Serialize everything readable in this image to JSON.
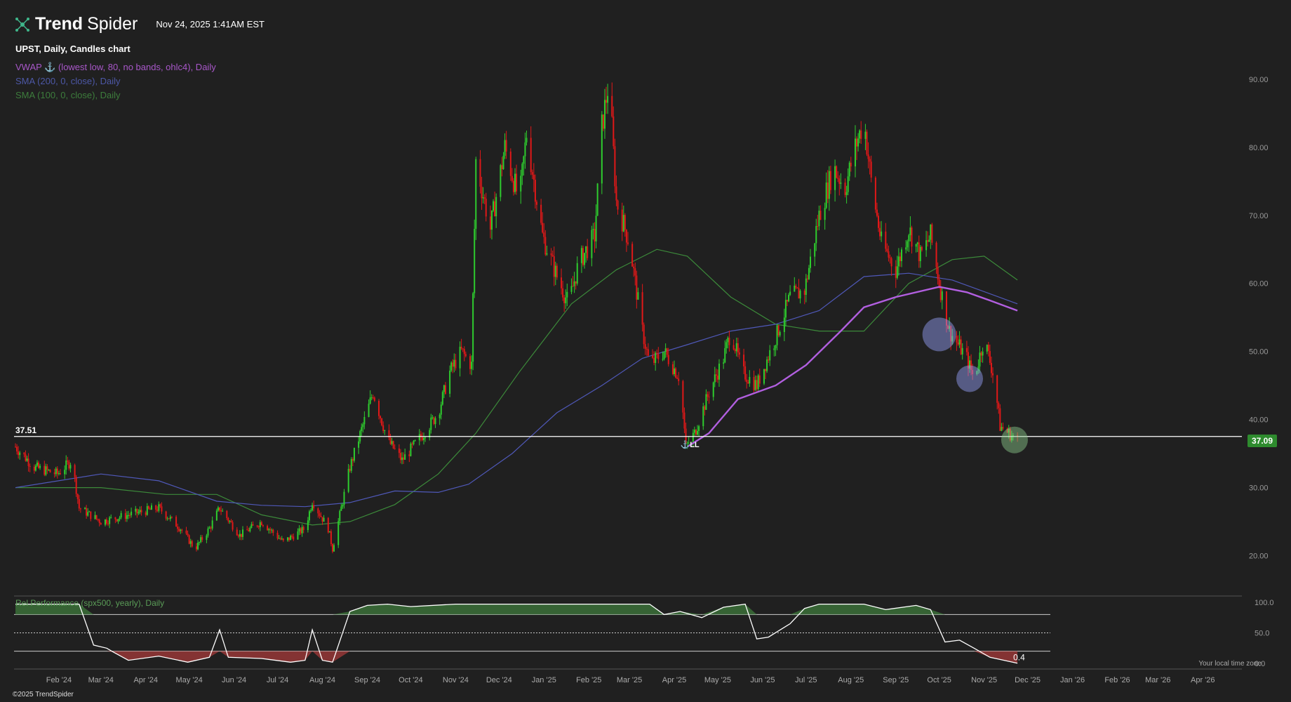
{
  "app": {
    "logo_trend": "Trend",
    "logo_spider": "Spider",
    "timestamp": "Nov 24, 2025 1:41AM EST",
    "copyright": "©2025 TrendSpider",
    "local_time_note": "Your local time zone"
  },
  "legend": {
    "title": "UPST, Daily, Candles chart",
    "vwap": "VWAP ⚓ (lowest low, 80, no bands, ohlc4), Daily",
    "sma200": "SMA (200, 0, close), Daily",
    "sma100": "SMA (100, 0, close), Daily"
  },
  "lower_pane": {
    "label": "Rel Performance (spx500, yearly), Daily",
    "last_value": "0.4",
    "y_ticks": [
      "100.0",
      "50.0",
      "0.0"
    ]
  },
  "colors": {
    "background": "#202020",
    "up": "#2ecc2e",
    "down": "#e01818",
    "vwap": "#b25fe0",
    "sma200": "#4f58b8",
    "sma100": "#3c8a3a",
    "price_tag": "#2e8b2e"
  },
  "annotations": {
    "level_label": "37.51",
    "anchor_label": "⚓LL",
    "price_tag": "37.09"
  },
  "chart_data": {
    "type": "candlestick",
    "symbol": "UPST",
    "interval": "Daily",
    "ylim": [
      15,
      97
    ],
    "y_ticks": [
      20,
      30,
      40,
      50,
      60,
      70,
      80,
      90
    ],
    "horizontal_level": 37.51,
    "last_price": 37.09,
    "x_ticks": [
      "Feb '24",
      "Mar '24",
      "Apr '24",
      "May '24",
      "Jun '24",
      "Jul '24",
      "Aug '24",
      "Sep '24",
      "Oct '24",
      "Nov '24",
      "Dec '24",
      "Jan '25",
      "Feb '25",
      "Mar '25",
      "Apr '25",
      "May '25",
      "Jun '25",
      "Jul '25",
      "Aug '25",
      "Sep '25",
      "Oct '25",
      "Nov '25",
      "Dec '25",
      "Jan '26",
      "Feb '26",
      "Mar '26",
      "Apr '26"
    ],
    "x_tick_dates": [
      "2024-02-01",
      "2024-03-01",
      "2024-04-01",
      "2024-05-01",
      "2024-06-01",
      "2024-07-01",
      "2024-08-01",
      "2024-09-01",
      "2024-10-01",
      "2024-11-01",
      "2024-12-01",
      "2025-01-01",
      "2025-02-01",
      "2025-03-01",
      "2025-04-01",
      "2025-05-01",
      "2025-06-01",
      "2025-07-01",
      "2025-08-01",
      "2025-09-01",
      "2025-10-01",
      "2025-11-01",
      "2025-12-01",
      "2026-01-01",
      "2026-02-01",
      "2026-03-01",
      "2026-04-01"
    ],
    "date_range": [
      "2024-01-02",
      "2026-04-28"
    ],
    "close_path": [
      [
        "2024-01-02",
        36
      ],
      [
        "2024-01-15",
        33
      ],
      [
        "2024-01-31",
        32
      ],
      [
        "2024-02-10",
        34
      ],
      [
        "2024-02-15",
        27
      ],
      [
        "2024-03-01",
        25
      ],
      [
        "2024-03-20",
        26
      ],
      [
        "2024-04-10",
        27
      ],
      [
        "2024-04-25",
        24
      ],
      [
        "2024-05-05",
        21
      ],
      [
        "2024-05-15",
        24
      ],
      [
        "2024-05-22",
        27
      ],
      [
        "2024-06-05",
        23
      ],
      [
        "2024-06-20",
        25
      ],
      [
        "2024-07-05",
        22
      ],
      [
        "2024-07-20",
        24
      ],
      [
        "2024-07-25",
        28
      ],
      [
        "2024-08-05",
        24
      ],
      [
        "2024-08-08",
        21
      ],
      [
        "2024-08-20",
        33
      ],
      [
        "2024-09-05",
        44
      ],
      [
        "2024-09-15",
        37
      ],
      [
        "2024-09-25",
        34
      ],
      [
        "2024-10-10",
        38
      ],
      [
        "2024-10-20",
        41
      ],
      [
        "2024-10-28",
        47
      ],
      [
        "2024-11-05",
        50
      ],
      [
        "2024-11-12",
        48
      ],
      [
        "2024-11-15",
        78
      ],
      [
        "2024-11-25",
        68
      ],
      [
        "2024-12-05",
        80
      ],
      [
        "2024-12-15",
        72
      ],
      [
        "2024-12-20",
        82
      ],
      [
        "2024-12-31",
        67
      ],
      [
        "2025-01-10",
        61
      ],
      [
        "2025-01-18",
        57
      ],
      [
        "2025-01-25",
        63
      ],
      [
        "2025-02-05",
        67
      ],
      [
        "2025-02-10",
        83
      ],
      [
        "2025-02-15",
        90
      ],
      [
        "2025-02-20",
        72
      ],
      [
        "2025-03-01",
        66
      ],
      [
        "2025-03-10",
        53
      ],
      [
        "2025-03-15",
        48
      ],
      [
        "2025-03-25",
        50
      ],
      [
        "2025-04-05",
        46
      ],
      [
        "2025-04-09",
        36
      ],
      [
        "2025-04-15",
        38
      ],
      [
        "2025-04-25",
        44
      ],
      [
        "2025-05-05",
        49
      ],
      [
        "2025-05-10",
        53
      ],
      [
        "2025-05-18",
        47
      ],
      [
        "2025-05-28",
        45
      ],
      [
        "2025-06-10",
        52
      ],
      [
        "2025-06-20",
        58
      ],
      [
        "2025-06-30",
        59
      ],
      [
        "2025-07-10",
        70
      ],
      [
        "2025-07-20",
        77
      ],
      [
        "2025-07-28",
        74
      ],
      [
        "2025-08-04",
        80
      ],
      [
        "2025-08-10",
        84
      ],
      [
        "2025-08-15",
        75
      ],
      [
        "2025-08-22",
        66
      ],
      [
        "2025-09-01",
        62
      ],
      [
        "2025-09-10",
        68
      ],
      [
        "2025-09-18",
        64
      ],
      [
        "2025-09-25",
        67
      ],
      [
        "2025-10-02",
        59
      ],
      [
        "2025-10-08",
        53
      ],
      [
        "2025-10-20",
        49
      ],
      [
        "2025-10-25",
        46
      ],
      [
        "2025-11-01",
        52
      ],
      [
        "2025-11-08",
        46
      ],
      [
        "2025-11-12",
        39
      ],
      [
        "2025-11-18",
        38
      ],
      [
        "2025-11-24",
        37
      ]
    ],
    "sma200": [
      [
        "2024-01-02",
        30
      ],
      [
        "2024-03-01",
        32
      ],
      [
        "2024-04-10",
        31
      ],
      [
        "2024-05-20",
        28
      ],
      [
        "2024-06-20",
        27.4
      ],
      [
        "2024-07-20",
        27.2
      ],
      [
        "2024-08-20",
        27.8
      ],
      [
        "2024-09-20",
        29.5
      ],
      [
        "2024-10-20",
        29.3
      ],
      [
        "2024-11-10",
        30.5
      ],
      [
        "2024-12-10",
        35
      ],
      [
        "2025-01-10",
        41
      ],
      [
        "2025-02-10",
        45
      ],
      [
        "2025-03-10",
        49
      ],
      [
        "2025-04-10",
        51
      ],
      [
        "2025-05-10",
        53
      ],
      [
        "2025-06-10",
        54
      ],
      [
        "2025-07-10",
        56
      ],
      [
        "2025-08-10",
        61
      ],
      [
        "2025-09-10",
        61.5
      ],
      [
        "2025-10-10",
        60.5
      ],
      [
        "2025-11-24",
        57
      ]
    ],
    "sma100": [
      [
        "2024-01-02",
        30
      ],
      [
        "2024-03-01",
        30
      ],
      [
        "2024-04-15",
        29
      ],
      [
        "2024-05-20",
        29
      ],
      [
        "2024-06-20",
        26
      ],
      [
        "2024-07-25",
        24.5
      ],
      [
        "2024-08-20",
        25
      ],
      [
        "2024-09-20",
        27.5
      ],
      [
        "2024-10-20",
        32
      ],
      [
        "2024-11-15",
        38
      ],
      [
        "2024-12-15",
        47
      ],
      [
        "2025-01-20",
        57
      ],
      [
        "2025-02-20",
        62
      ],
      [
        "2025-03-20",
        65
      ],
      [
        "2025-04-10",
        64
      ],
      [
        "2025-05-10",
        58
      ],
      [
        "2025-06-10",
        54
      ],
      [
        "2025-07-10",
        53
      ],
      [
        "2025-08-10",
        53
      ],
      [
        "2025-09-10",
        60
      ],
      [
        "2025-10-10",
        63.5
      ],
      [
        "2025-11-01",
        64
      ],
      [
        "2025-11-24",
        60.5
      ]
    ],
    "vwap": [
      [
        "2025-04-10",
        36
      ],
      [
        "2025-04-25",
        38
      ],
      [
        "2025-05-15",
        43
      ],
      [
        "2025-06-10",
        45
      ],
      [
        "2025-07-01",
        48
      ],
      [
        "2025-07-25",
        53
      ],
      [
        "2025-08-10",
        56.5
      ],
      [
        "2025-09-01",
        58
      ],
      [
        "2025-10-01",
        59.5
      ],
      [
        "2025-10-20",
        58.7
      ],
      [
        "2025-11-05",
        57.5
      ],
      [
        "2025-11-24",
        56
      ]
    ],
    "highlight_circles": [
      {
        "date": "2025-10-01",
        "price": 52.5,
        "color": "#9aa5ff"
      },
      {
        "date": "2025-10-22",
        "price": 46,
        "color": "#9aa5ff"
      },
      {
        "date": "2025-11-22",
        "price": 37,
        "color": "#8fcf8f"
      }
    ],
    "rel_performance": {
      "ylim": [
        0,
        100
      ],
      "levels": [
        80,
        50,
        20
      ],
      "points": [
        [
          "2024-01-02",
          97
        ],
        [
          "2024-02-15",
          97
        ],
        [
          "2024-02-25",
          30
        ],
        [
          "2024-03-05",
          25
        ],
        [
          "2024-03-10",
          18
        ],
        [
          "2024-03-20",
          5
        ],
        [
          "2024-04-10",
          12
        ],
        [
          "2024-04-30",
          2
        ],
        [
          "2024-05-15",
          10
        ],
        [
          "2024-05-22",
          55
        ],
        [
          "2024-05-28",
          10
        ],
        [
          "2024-06-20",
          8
        ],
        [
          "2024-07-10",
          2
        ],
        [
          "2024-07-20",
          5
        ],
        [
          "2024-07-25",
          55
        ],
        [
          "2024-08-01",
          5
        ],
        [
          "2024-08-08",
          2
        ],
        [
          "2024-08-20",
          85
        ],
        [
          "2024-09-01",
          95
        ],
        [
          "2024-09-15",
          97
        ],
        [
          "2024-10-01",
          93
        ],
        [
          "2024-11-01",
          97
        ],
        [
          "2024-12-01",
          97
        ],
        [
          "2025-01-01",
          97
        ],
        [
          "2025-02-01",
          97
        ],
        [
          "2025-03-15",
          97
        ],
        [
          "2025-03-25",
          80
        ],
        [
          "2025-04-05",
          85
        ],
        [
          "2025-04-20",
          75
        ],
        [
          "2025-05-05",
          92
        ],
        [
          "2025-05-20",
          97
        ],
        [
          "2025-05-28",
          40
        ],
        [
          "2025-06-05",
          43
        ],
        [
          "2025-06-20",
          65
        ],
        [
          "2025-06-30",
          90
        ],
        [
          "2025-07-10",
          97
        ],
        [
          "2025-08-10",
          97
        ],
        [
          "2025-08-25",
          88
        ],
        [
          "2025-09-15",
          95
        ],
        [
          "2025-09-25",
          88
        ],
        [
          "2025-10-05",
          35
        ],
        [
          "2025-10-15",
          38
        ],
        [
          "2025-10-25",
          25
        ],
        [
          "2025-11-05",
          10
        ],
        [
          "2025-11-24",
          0.4
        ]
      ]
    }
  }
}
